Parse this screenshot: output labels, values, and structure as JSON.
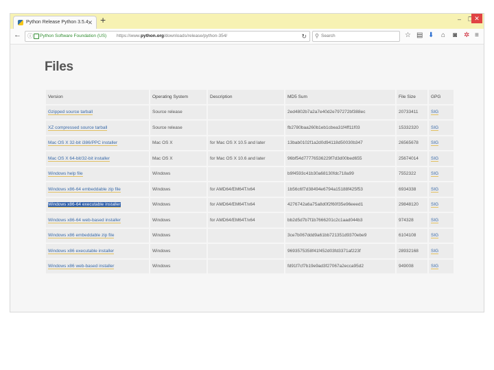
{
  "browser": {
    "tab_title": "Python Release Python 3.5.4",
    "tab_close": "✕",
    "new_tab": "+",
    "window_controls": {
      "minimize": "–",
      "maximize": "❐",
      "close": "✕"
    }
  },
  "nav": {
    "back": "←",
    "info": "ⓘ",
    "org": "Python Software Foundation (US)",
    "url_prefix": "https://www.",
    "url_domain": "python.org",
    "url_path": "/downloads/release/python-354/",
    "reload": "↻",
    "search_placeholder": "Search",
    "search_icon": "magnifier-icon"
  },
  "toolbar_icons": [
    "bookmark-star-icon",
    "reading-list-icon",
    "download-icon",
    "home-icon",
    "pocket-icon",
    "extension-icon",
    "menu-icon"
  ],
  "page": {
    "heading": "Files",
    "columns": [
      "Version",
      "Operating System",
      "Description",
      "MD5 Sum",
      "File Size",
      "GPG"
    ],
    "rows": [
      [
        "Gzipped source tarball",
        "Source release",
        "",
        "2ed4802b7a2a7e40d2e797272bf388ec",
        "20733411",
        "SIG"
      ],
      [
        "XZ compressed source tarball",
        "Source release",
        "",
        "fb2780baa260b1eb1cbea31f4ff11f03",
        "15332320",
        "SIG"
      ],
      [
        "Mac OS X 32-bit i386/PPC installer",
        "Mac OS X",
        "for Mac OS X 10.5 and later",
        "13bab0102f1a2d0d94118d50030b347",
        "26565678",
        "SIG"
      ],
      [
        "Mac OS X 64-bit/32-bit installer",
        "Mac OS X",
        "for Mac OS X 10.6 and later",
        "96bf54d77776536229f7d3d00bed655",
        "25674014",
        "SIG"
      ],
      [
        "Windows help file",
        "Windows",
        "",
        "b9f4593c41b30a68130fdc718a99",
        "7552322",
        "SIG"
      ],
      [
        "Windows x86-64 embeddable zip file",
        "Windows",
        "for AMD64/EM64T/x64",
        "1b56c6f7d38494e6794a15188f425f53",
        "6934338",
        "SIG"
      ],
      [
        "Windows x86-64 executable installer",
        "Windows",
        "for AMD64/EM64T/x64",
        "4276742a6a75a8d0f2f60f35e96eeed1",
        "29848120",
        "SIG"
      ],
      [
        "Windows x86-64 web-based installer",
        "Windows",
        "for AMD64/EM64T/x64",
        "bb2d5d7b7f1b7666201c2c1aad044b3",
        "974328",
        "SIG"
      ],
      [
        "Windows x86 embeddable zip file",
        "Windows",
        "",
        "3ce7b067ddd9a61bb721351d9370ebe9",
        "6104108",
        "SIG"
      ],
      [
        "Windows x86 executable installer",
        "Windows",
        "",
        "9693575358f41f452d03fd3371af223f",
        "28932168",
        "SIG"
      ],
      [
        "Windows x86 web-based installer",
        "Windows",
        "",
        "fd91f7cf7b19e9ad3f27067a2ecca95d2",
        "949008",
        "SIG"
      ]
    ],
    "selected_row": 6
  },
  "colors": {
    "tabbar": "#f7f2b3",
    "link": "#3a6aa8",
    "link_underline": "#e2c060",
    "selection": "#2f5faa",
    "cell": "#ececec"
  }
}
